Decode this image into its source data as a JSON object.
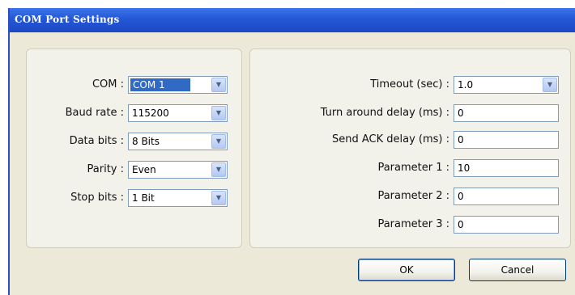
{
  "window": {
    "title": "COM Port Settings"
  },
  "left_panel": {
    "fields": [
      {
        "label": "COM :",
        "value": "COM 1",
        "selected": true
      },
      {
        "label": "Baud rate :",
        "value": "115200"
      },
      {
        "label": "Data bits :",
        "value": "8 Bits"
      },
      {
        "label": "Parity :",
        "value": "Even"
      },
      {
        "label": "Stop bits :",
        "value": "1 Bit"
      }
    ]
  },
  "right_panel": {
    "timeout": {
      "label": "Timeout (sec) :",
      "value": "1.0"
    },
    "turn_around": {
      "label": "Turn around delay (ms) :",
      "value": "0"
    },
    "send_ack": {
      "label": "Send ACK delay (ms) :",
      "value": "0"
    },
    "param1": {
      "label": "Parameter 1 :",
      "value": "10"
    },
    "param2": {
      "label": "Parameter 2 :",
      "value": "0"
    },
    "param3": {
      "label": "Parameter 3 :",
      "value": "0"
    }
  },
  "buttons": {
    "ok": "OK",
    "cancel": "Cancel"
  },
  "icons": {
    "dropdown": "chevron-down-icon"
  },
  "colors": {
    "titlebar": "#2457d6",
    "selection": "#316ac5",
    "dialog_bg": "#ece9d8"
  }
}
